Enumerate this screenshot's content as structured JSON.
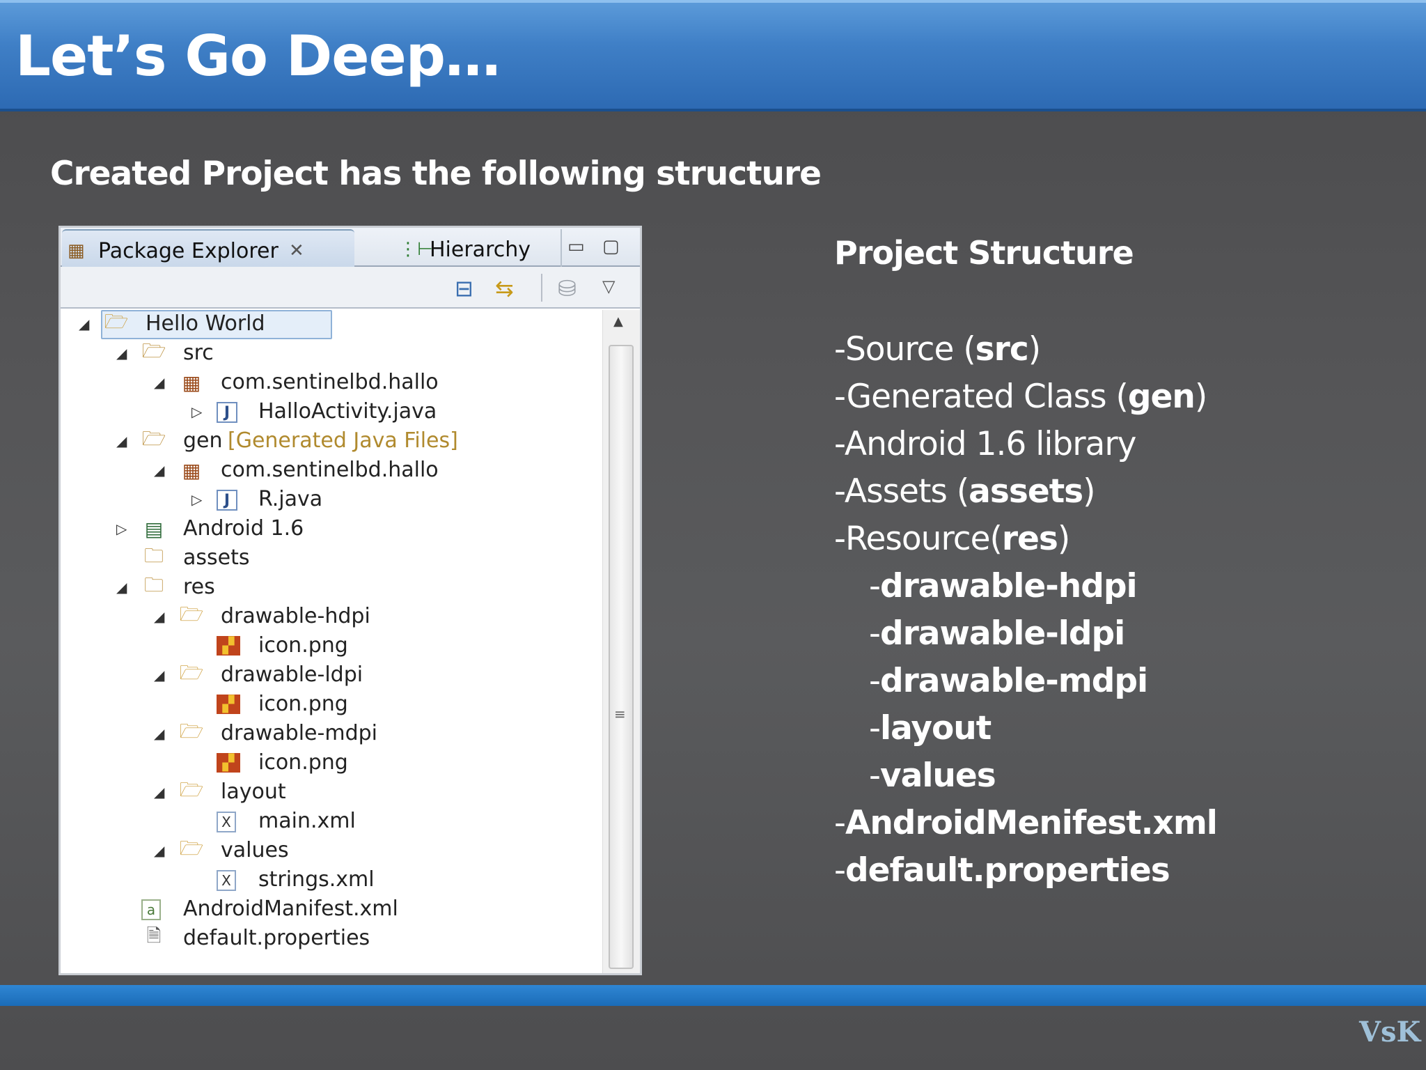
{
  "title": "Let’s Go Deep…",
  "subtitle": "Created Project has the following structure",
  "explorer": {
    "tabs": [
      {
        "label": "Package Explorer",
        "close_glyph": "✕",
        "icon": "package-explorer-icon"
      },
      {
        "label": "Hierarchy",
        "icon": "hierarchy-icon"
      }
    ],
    "window_buttons": {
      "minimize": "▭",
      "maximize": "▢"
    },
    "toolbar_icons": [
      "collapse-all-icon",
      "link-with-editor-icon",
      "filter-icon",
      "view-menu-icon"
    ],
    "tree": [
      {
        "label": "Hello World",
        "twisty": "◢",
        "icon": "project-folder-icon",
        "selected": true
      },
      {
        "label": "src",
        "twisty": "◢",
        "icon": "source-folder-icon"
      },
      {
        "label": "com.sentinelbd.hallo",
        "twisty": "◢",
        "icon": "package-icon"
      },
      {
        "label": "HalloActivity.java",
        "twisty": "▷",
        "icon": "java-file-icon"
      },
      {
        "label": "gen",
        "decoration": "[Generated Java Files]",
        "twisty": "◢",
        "icon": "source-folder-icon"
      },
      {
        "label": "com.sentinelbd.hallo",
        "twisty": "◢",
        "icon": "package-icon"
      },
      {
        "label": "R.java",
        "twisty": "▷",
        "icon": "java-file-icon"
      },
      {
        "label": "Android 1.6",
        "twisty": "▷",
        "icon": "library-icon"
      },
      {
        "label": "assets",
        "twisty": "",
        "icon": "folder-icon"
      },
      {
        "label": "res",
        "twisty": "◢",
        "icon": "folder-icon"
      },
      {
        "label": "drawable-hdpi",
        "twisty": "◢",
        "icon": "open-folder-icon"
      },
      {
        "label": "icon.png",
        "twisty": "",
        "icon": "image-file-icon"
      },
      {
        "label": "drawable-ldpi",
        "twisty": "◢",
        "icon": "open-folder-icon"
      },
      {
        "label": "icon.png",
        "twisty": "",
        "icon": "image-file-icon"
      },
      {
        "label": "drawable-mdpi",
        "twisty": "◢",
        "icon": "open-folder-icon"
      },
      {
        "label": "icon.png",
        "twisty": "",
        "icon": "image-file-icon"
      },
      {
        "label": "layout",
        "twisty": "◢",
        "icon": "open-folder-icon"
      },
      {
        "label": "main.xml",
        "twisty": "",
        "icon": "xml-file-icon"
      },
      {
        "label": "values",
        "twisty": "◢",
        "icon": "open-folder-icon"
      },
      {
        "label": "strings.xml",
        "twisty": "",
        "icon": "xml-file-icon"
      },
      {
        "label": "AndroidManifest.xml",
        "twisty": "",
        "icon": "manifest-file-icon"
      },
      {
        "label": "default.properties",
        "twisty": "",
        "icon": "text-file-icon"
      }
    ]
  },
  "structure": {
    "heading": "Project Structure",
    "lines": [
      {
        "prefix": "-Source (",
        "bold": "src",
        "suffix": ")"
      },
      {
        "prefix": "-Generated Class (",
        "bold": "gen",
        "suffix": ")"
      },
      {
        "prefix": "-Android 1.6 library",
        "bold": "",
        "suffix": ""
      },
      {
        "prefix": "-Assets (",
        "bold": "assets",
        "suffix": ")"
      },
      {
        "prefix": "-Resource(",
        "bold": "res",
        "suffix": ")"
      },
      {
        "prefix": "-",
        "bold": "drawable-hdpi",
        "suffix": ""
      },
      {
        "prefix": "-",
        "bold": "drawable-ldpi",
        "suffix": ""
      },
      {
        "prefix": "-",
        "bold": "drawable-mdpi",
        "suffix": ""
      },
      {
        "prefix": "-",
        "bold": "layout",
        "suffix": ""
      },
      {
        "prefix": "-",
        "bold": "values",
        "suffix": ""
      },
      {
        "prefix": "-",
        "bold": "AndroidMenifest.xml",
        "suffix": ""
      },
      {
        "prefix": "-",
        "bold": "default.properties",
        "suffix": ""
      }
    ]
  },
  "watermark": "VsK",
  "colors": {
    "header": "#3f7fc6",
    "bottom_bar": "#2f86d3",
    "package_brown": "#9a4a1a"
  }
}
